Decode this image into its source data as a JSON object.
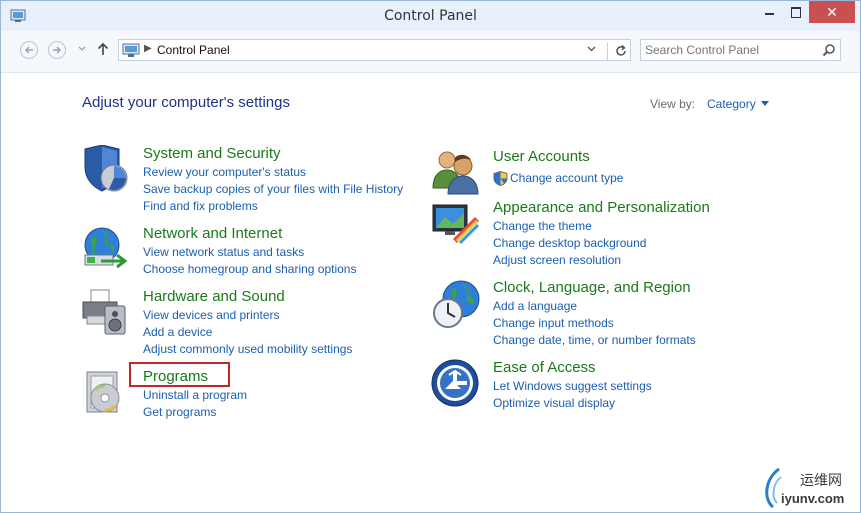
{
  "window": {
    "title": "Control Panel"
  },
  "navbar": {
    "breadcrumb": "Control Panel",
    "search_placeholder": "Search Control Panel"
  },
  "content": {
    "heading": "Adjust your computer's settings",
    "view_by_label": "View by:",
    "view_by_value": "Category"
  },
  "categories_left": [
    {
      "title": "System and Security",
      "icon": "shield-icon",
      "links": [
        "Review your computer's status",
        "Save backup copies of your files with File History",
        "Find and fix problems"
      ]
    },
    {
      "title": "Network and Internet",
      "icon": "network-globe-icon",
      "links": [
        "View network status and tasks",
        "Choose homegroup and sharing options"
      ]
    },
    {
      "title": "Hardware and Sound",
      "icon": "printer-speaker-icon",
      "links": [
        "View devices and printers",
        "Add a device",
        "Adjust commonly used mobility settings"
      ]
    },
    {
      "title": "Programs",
      "icon": "programs-disc-icon",
      "links": [
        "Uninstall a program",
        "Get programs"
      ]
    }
  ],
  "categories_right": [
    {
      "title": "User Accounts",
      "icon": "users-icon",
      "links": [
        "Change account type"
      ]
    },
    {
      "title": "Appearance and Personalization",
      "icon": "monitor-palette-icon",
      "links": [
        "Change the theme",
        "Change desktop background",
        "Adjust screen resolution"
      ]
    },
    {
      "title": "Clock, Language, and Region",
      "icon": "clock-globe-icon",
      "links": [
        "Add a language",
        "Change input methods",
        "Change date, time, or number formats"
      ]
    },
    {
      "title": "Ease of Access",
      "icon": "ease-of-access-icon",
      "links": [
        "Let Windows suggest settings",
        "Optimize visual display"
      ]
    }
  ],
  "watermark": {
    "line1": "运维网",
    "line2": "iyunv.com"
  },
  "colors": {
    "category_title": "#1a7a1a",
    "link": "#1a5fb4",
    "heading": "#1e3287",
    "highlight": "#c0282a",
    "close_button": "#c75050"
  }
}
